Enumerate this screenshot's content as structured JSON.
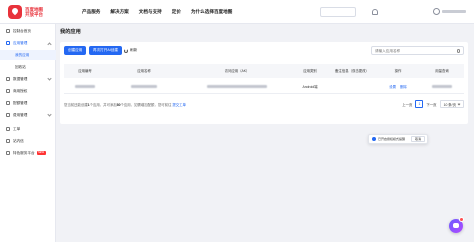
{
  "brand": {
    "line1": "百度地图",
    "line2": "开放平台"
  },
  "nav": {
    "items": [
      "产品服务",
      "解决方案",
      "文档与支持",
      "定价",
      "为什么选择百度地图"
    ]
  },
  "sidebar": {
    "items": [
      {
        "label": "控制台首页"
      },
      {
        "label": "应用管理"
      },
      {
        "label": "我的应用"
      },
      {
        "label": "回收站"
      },
      {
        "label": "数据管理"
      },
      {
        "label": "商用授权"
      },
      {
        "label": "配额管理"
      },
      {
        "label": "费用管理"
      },
      {
        "label": "工单"
      },
      {
        "label": "站内信"
      },
      {
        "label": "特色服务平台",
        "badge": "NEW"
      }
    ]
  },
  "main": {
    "title": "我的应用",
    "create_button": "创建应用",
    "create_ai_button": "再次打开AI创建",
    "refresh_label": "刷新",
    "search_placeholder": "请输入应用名称"
  },
  "table": {
    "headers": [
      "应用编号",
      "应用名称",
      "访问应用（AK）",
      "应用类别",
      "备注信息（双击更改）",
      "操作",
      "用量查询"
    ],
    "row": {
      "type": "Android端",
      "op_set": "设置",
      "op_delete": "删除"
    }
  },
  "footer": {
    "tip_prefix": "您当前还能创建",
    "tip_count": "1",
    "tip_mid": "个应用，并可添加",
    "tip_count2": "80",
    "tip_suffix": "个应用，如需增加配额，您可前往",
    "tip_link": "提交工单",
    "prev": "上一页",
    "page": "1",
    "next": "下一页",
    "page_size": "10 条/页"
  },
  "toast": {
    "text": "已开启授权模式提醒",
    "button": "取消"
  }
}
